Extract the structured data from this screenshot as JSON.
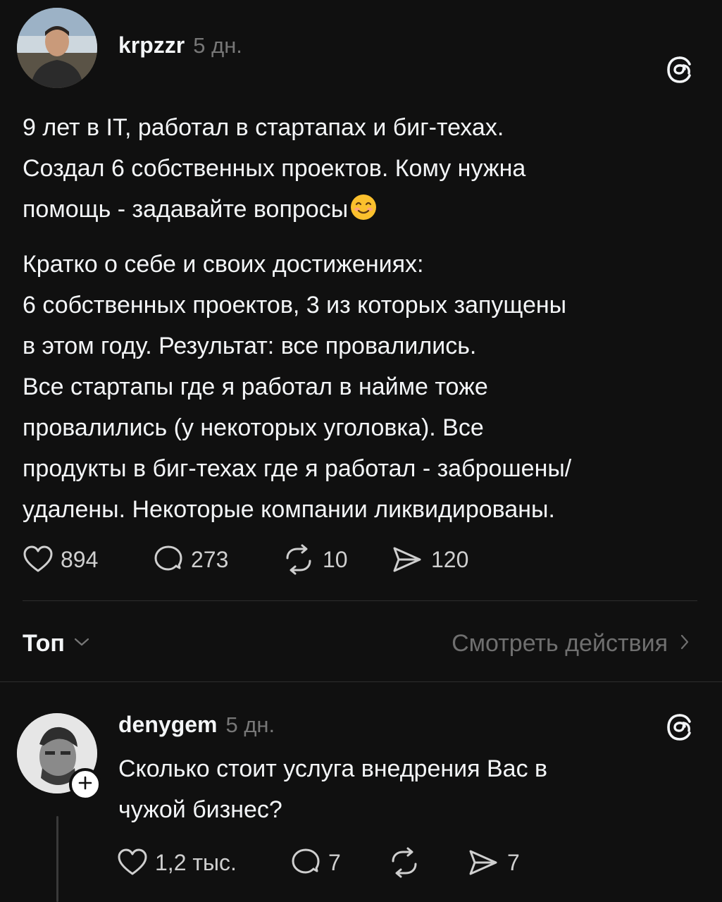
{
  "post": {
    "author": "krpzzr",
    "time": "5 дн.",
    "paragraphs": [
      {
        "lines": [
          "9 лет в IT, работал в стартапах и биг-техах.",
          "Создал 6 собственных проектов. Кому нужна",
          "помощь - задавайте вопросы"
        ],
        "emoji": "smiling-face"
      },
      {
        "lines": [
          "Кратко о себе и своих достижениях:",
          "6 собственных проектов, 3 из которых запущены",
          "в этом году. Результат: все провалились.",
          "Все стартапы где я работал в найме тоже",
          "провалились (у некоторых уголовка). Все",
          "продукты в биг-техах где я работал - заброшены/",
          "удалены. Некоторые компании ликвидированы."
        ]
      }
    ],
    "stats": {
      "likes": "894",
      "comments": "273",
      "reposts": "10",
      "shares": "120"
    }
  },
  "sort": {
    "label": "Топ",
    "view_activity": "Смотреть действия"
  },
  "reply": {
    "author": "denygem",
    "time": "5 дн.",
    "lines": [
      "Сколько стоит услуга внедрения Вас в",
      "чужой бизнес?"
    ],
    "stats": {
      "likes": "1,2 тыс.",
      "comments": "7",
      "shares": "7"
    }
  },
  "icons": [
    "threads-logo-icon",
    "heart-icon",
    "comment-icon",
    "repost-icon",
    "share-icon",
    "chevron-down-icon",
    "chevron-right-icon",
    "plus-icon"
  ],
  "colors": {
    "background": "#101010",
    "text": "#f3f5f7",
    "secondary": "#777777"
  }
}
